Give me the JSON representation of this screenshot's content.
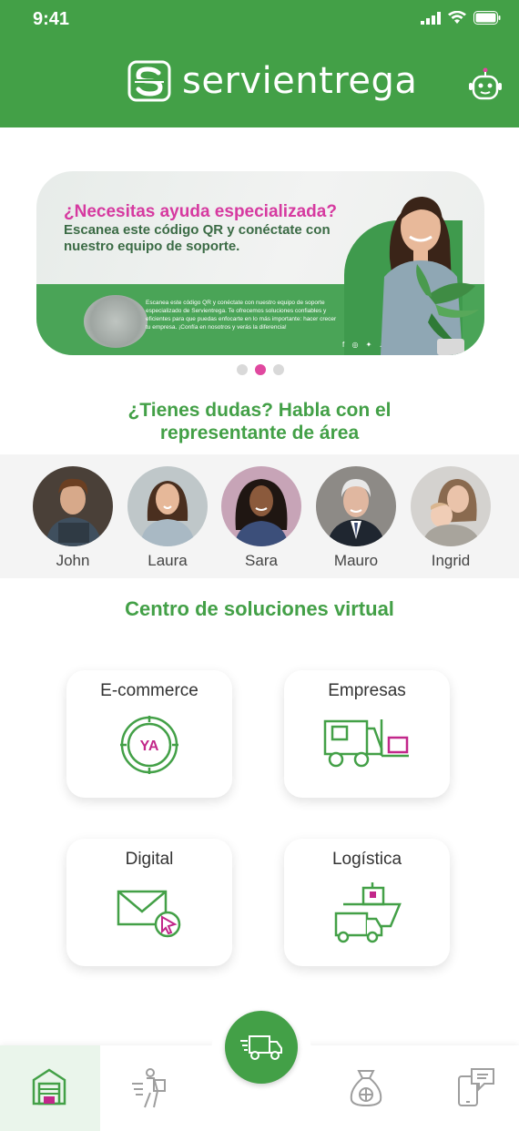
{
  "status": {
    "time": "9:41"
  },
  "header": {
    "brand": "servientrega"
  },
  "banner": {
    "headline": "¿Necesitas ayuda especializada?",
    "subline": "Escanea este código QR y conéctate con nuestro equipo de soporte.",
    "body": "Escanea este código QR y conéctate con nuestro equipo de soporte especializado de Servientrega. Te ofrecemos soluciones confiables y eficientes para que puedas enfocarte en lo más importante: hacer crecer tu empresa. ¡Confía en nosotros y verás la diferencia!",
    "social": "f ◎ ✦ ♪ in ▶",
    "active_slide": 2,
    "slide_count": 3
  },
  "reps_section": {
    "title": "¿Tienes dudas? Habla con el representante de área",
    "reps": [
      {
        "name": "John"
      },
      {
        "name": "Laura"
      },
      {
        "name": "Sara"
      },
      {
        "name": "Mauro"
      },
      {
        "name": "Ingrid"
      }
    ]
  },
  "solutions": {
    "title": "Centro de soluciones virtual",
    "cards": [
      {
        "label": "E-commerce",
        "icon": "ya-clock-icon",
        "icon_text": "YA"
      },
      {
        "label": "Empresas",
        "icon": "forklift-icon"
      },
      {
        "label": "Digital",
        "icon": "email-cursor-icon"
      },
      {
        "label": "Logística",
        "icon": "ship-truck-icon"
      }
    ]
  },
  "bottom_nav": {
    "items": [
      {
        "icon": "warehouse-icon",
        "active": true
      },
      {
        "icon": "delivery-person-icon",
        "active": false
      },
      {
        "icon": "delivery-truck-icon",
        "active": false
      },
      {
        "icon": "money-bag-icon",
        "active": false
      },
      {
        "icon": "device-chat-icon",
        "active": false
      }
    ]
  },
  "colors": {
    "brand_green": "#43a047",
    "accent_pink": "#e0489f",
    "dot_inactive": "#d9d9d9",
    "rep_bg": "#f4f4f4"
  }
}
